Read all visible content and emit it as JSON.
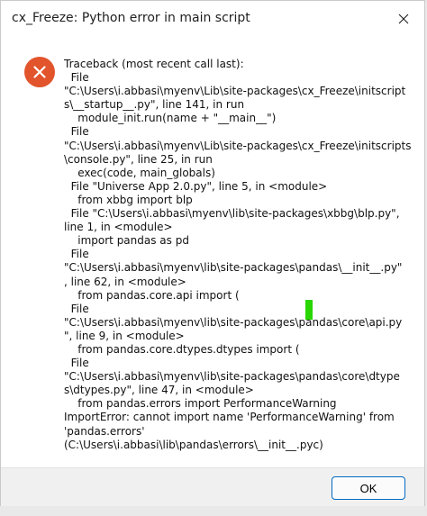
{
  "window": {
    "title": "cx_Freeze: Python error in main script"
  },
  "icons": {
    "close": "close-icon",
    "error": "error-icon"
  },
  "colors": {
    "error_red": "#e2542b",
    "accent": "#0067c0",
    "marker_green": "#29d600"
  },
  "message": {
    "lines": [
      "Traceback (most recent call last):",
      "  File",
      "\"C:\\Users\\i.abbasi\\myenv\\Lib\\site-packages\\cx_Freeze\\initscript",
      "s\\__startup__.py\", line 141, in run",
      "    module_init.run(name + \"__main__\")",
      "  File",
      "\"C:\\Users\\i.abbasi\\myenv\\Lib\\site-packages\\cx_Freeze\\initscripts",
      "\\console.py\", line 25, in run",
      "    exec(code, main_globals)",
      "  File \"Universe App 2.0.py\", line 5, in <module>",
      "    from xbbg import blp",
      "  File \"C:\\Users\\i.abbasi\\myenv\\lib\\site-packages\\xbbg\\blp.py\",",
      "line 1, in <module>",
      "    import pandas as pd",
      "  File",
      "\"C:\\Users\\i.abbasi\\myenv\\lib\\site-packages\\pandas\\__init__.py\"",
      ", line 62, in <module>",
      "    from pandas.core.api import (",
      "  File",
      "\"C:\\Users\\i.abbasi\\myenv\\lib\\site-packages\\pandas\\core\\api.py",
      "\", line 9, in <module>",
      "    from pandas.core.dtypes.dtypes import (",
      "  File",
      "\"C:\\Users\\i.abbasi\\myenv\\lib\\site-packages\\pandas\\core\\dtype",
      "s\\dtypes.py\", line 47, in <module>",
      "    from pandas.errors import PerformanceWarning",
      "ImportError: cannot import name 'PerformanceWarning' from",
      "'pandas.errors'",
      "(C:\\Users\\i.abbasi\\lib\\pandas\\errors\\__init__.pyc)"
    ]
  },
  "footer": {
    "ok_label": "OK"
  }
}
